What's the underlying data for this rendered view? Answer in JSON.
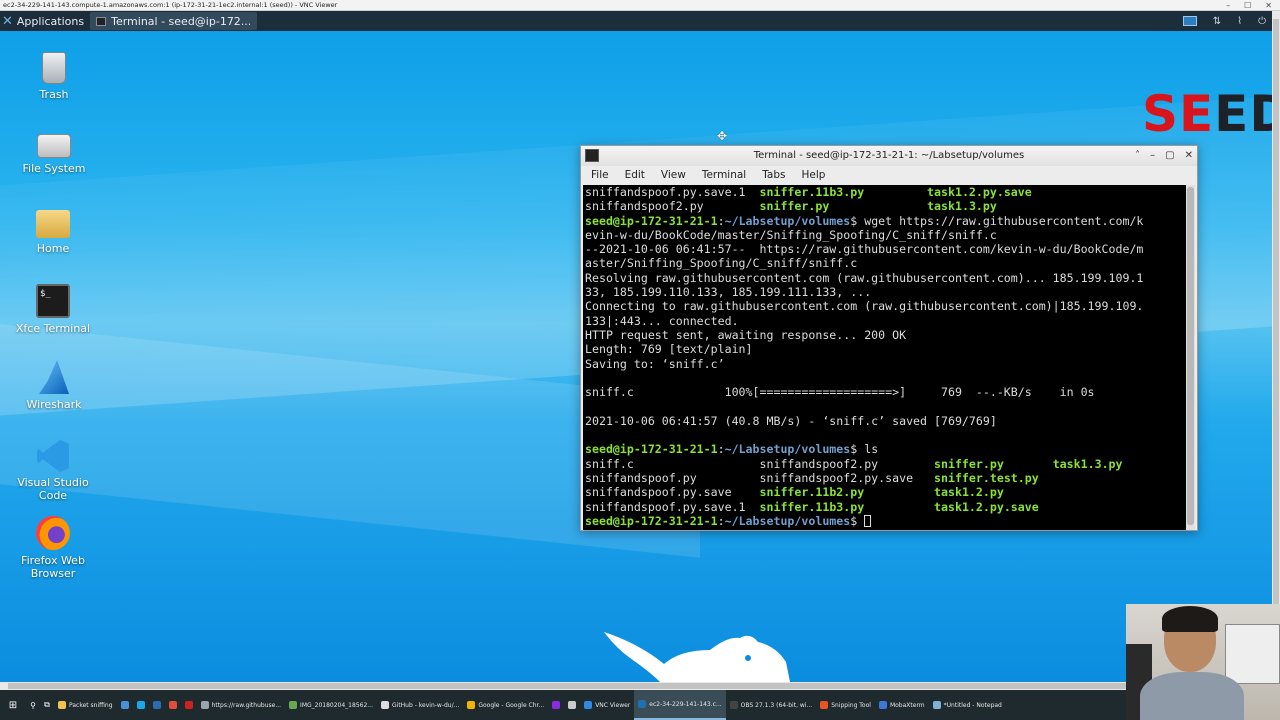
{
  "vnc": {
    "title": "ec2-34-229-141-143.compute-1.amazonaws.com:1 (ip-172-31-21-1ec2.internal:1 (seed)) - VNC Viewer",
    "minimize": "–",
    "maximize": "☐",
    "close": "✕"
  },
  "xfce_panel": {
    "applications_label": "Applications",
    "task_label": "Terminal - seed@ip-172...",
    "tray_symbols": [
      "⇅",
      "⌇",
      "⏻"
    ]
  },
  "desktop_icons": [
    {
      "label": "Trash",
      "icon": "trash-icon"
    },
    {
      "label": "File System",
      "icon": "drive-icon"
    },
    {
      "label": "Home",
      "icon": "folder-icon"
    },
    {
      "label": "Xfce Terminal",
      "icon": "terminal-icon"
    },
    {
      "label": "Wireshark",
      "icon": "wireshark-icon"
    },
    {
      "label": "Visual Studio Code",
      "icon": "vscode-icon"
    },
    {
      "label": "Firefox Web Browser",
      "icon": "firefox-icon"
    }
  ],
  "terminal_glyph": "$_",
  "seed_logo": {
    "letters": [
      "S",
      "E",
      "E",
      "D"
    ],
    "colors": [
      "#d9141b",
      "#d9141b",
      "#1d2128",
      "#1d2128"
    ]
  },
  "terminal": {
    "title": "Terminal - seed@ip-172-31-21-1: ~/Labsetup/volumes",
    "controls": [
      "˄",
      "–",
      "▢",
      "✕"
    ],
    "menu": [
      "File",
      "Edit",
      "View",
      "Terminal",
      "Tabs",
      "Help"
    ],
    "prompt_user": "seed@ip-172-31-21-1",
    "prompt_path": ":~/Labsetup/volumes",
    "prompt_end": "$",
    "lines": [
      [
        {
          "t": "sniffandspoof.py.save.1  ",
          "c": "w"
        },
        {
          "t": "sniffer.11b3.py",
          "c": "g"
        },
        {
          "t": "         ",
          "c": "w"
        },
        {
          "t": "task1.2.py.save",
          "c": "g"
        }
      ],
      [
        {
          "t": "sniffandspoof2.py        ",
          "c": "w"
        },
        {
          "t": "sniffer.py",
          "c": "g"
        },
        {
          "t": "              ",
          "c": "w"
        },
        {
          "t": "task1.3.py",
          "c": "g"
        }
      ],
      [
        {
          "t": "seed@ip-172-31-21-1",
          "c": "g"
        },
        {
          "t": ":",
          "c": "w"
        },
        {
          "t": "~/Labsetup/volumes",
          "c": "b"
        },
        {
          "t": "$ wget https://raw.githubusercontent.com/k",
          "c": "w"
        }
      ],
      [
        {
          "t": "evin-w-du/BookCode/master/Sniffing_Spoofing/C_sniff/sniff.c",
          "c": "w"
        }
      ],
      [
        {
          "t": "--2021-10-06 06:41:57--  https://raw.githubusercontent.com/kevin-w-du/BookCode/m",
          "c": "w"
        }
      ],
      [
        {
          "t": "aster/Sniffing_Spoofing/C_sniff/sniff.c",
          "c": "w"
        }
      ],
      [
        {
          "t": "Resolving raw.githubusercontent.com (raw.githubusercontent.com)... 185.199.109.1",
          "c": "w"
        }
      ],
      [
        {
          "t": "33, 185.199.110.133, 185.199.111.133, ...",
          "c": "w"
        }
      ],
      [
        {
          "t": "Connecting to raw.githubusercontent.com (raw.githubusercontent.com)|185.199.109.",
          "c": "w"
        }
      ],
      [
        {
          "t": "133|:443... connected.",
          "c": "w"
        }
      ],
      [
        {
          "t": "HTTP request sent, awaiting response... 200 OK",
          "c": "w"
        }
      ],
      [
        {
          "t": "Length: 769 [text/plain]",
          "c": "w"
        }
      ],
      [
        {
          "t": "Saving to: ‘sniff.c’",
          "c": "w"
        }
      ],
      [
        {
          "t": "",
          "c": "w"
        }
      ],
      [
        {
          "t": "sniff.c             100%[===================>]     769  --.-KB/s    in 0s",
          "c": "w"
        }
      ],
      [
        {
          "t": "",
          "c": "w"
        }
      ],
      [
        {
          "t": "2021-10-06 06:41:57 (40.8 MB/s) - ‘sniff.c’ saved [769/769]",
          "c": "w"
        }
      ],
      [
        {
          "t": "",
          "c": "w"
        }
      ],
      [
        {
          "t": "seed@ip-172-31-21-1",
          "c": "g"
        },
        {
          "t": ":",
          "c": "w"
        },
        {
          "t": "~/Labsetup/volumes",
          "c": "b"
        },
        {
          "t": "$ ls",
          "c": "w"
        }
      ],
      [
        {
          "t": "sniff.c                  sniffandspoof2.py        ",
          "c": "w"
        },
        {
          "t": "sniffer.py",
          "c": "g"
        },
        {
          "t": "       ",
          "c": "w"
        },
        {
          "t": "task1.3.py",
          "c": "g"
        }
      ],
      [
        {
          "t": "sniffandspoof.py         sniffandspoof2.py.save   ",
          "c": "w"
        },
        {
          "t": "sniffer.test.py",
          "c": "g"
        }
      ],
      [
        {
          "t": "sniffandspoof.py.save    ",
          "c": "w"
        },
        {
          "t": "sniffer.11b2.py",
          "c": "g"
        },
        {
          "t": "          ",
          "c": "w"
        },
        {
          "t": "task1.2.py",
          "c": "g"
        }
      ],
      [
        {
          "t": "sniffandspoof.py.save.1  ",
          "c": "w"
        },
        {
          "t": "sniffer.11b3.py",
          "c": "g"
        },
        {
          "t": "          ",
          "c": "w"
        },
        {
          "t": "task1.2.py.save",
          "c": "g"
        }
      ],
      [
        {
          "t": "seed@ip-172-31-21-1",
          "c": "g"
        },
        {
          "t": ":",
          "c": "w"
        },
        {
          "t": "~/Labsetup/volumes",
          "c": "b"
        },
        {
          "t": "$ ",
          "c": "w"
        },
        {
          "t": "",
          "c": "cursor"
        }
      ]
    ]
  },
  "win_taskbar": {
    "start_icon": "⊞",
    "sys_icons": [
      "⚲",
      "⧉"
    ],
    "items": [
      {
        "label": "Packet sniffing",
        "color": "#f2c14e"
      },
      {
        "label": "",
        "color": "#4a90d9"
      },
      {
        "label": "",
        "color": "#1aa7ec"
      },
      {
        "label": "",
        "color": "#2b6cb0"
      },
      {
        "label": "",
        "color": "#e04e39"
      },
      {
        "label": "",
        "color": "#cc2222"
      },
      {
        "label": "https://raw.githubuse...",
        "color": "#9aa4ab"
      },
      {
        "label": "IMG_20180204_18562...",
        "color": "#6aa84f"
      },
      {
        "label": "GitHub - kevin-w-du/...",
        "color": "#dddddd"
      },
      {
        "label": "Google - Google Chr...",
        "color": "#f4b400"
      },
      {
        "label": "",
        "color": "#8a2be2"
      },
      {
        "label": "",
        "color": "#cccccc"
      },
      {
        "label": "VNC Viewer",
        "color": "#2d8ae0"
      },
      {
        "label": "ec2-34-229-141-143.c...",
        "color": "#1f6fb2",
        "active": true
      },
      {
        "label": "OBS 27.1.3 (64-bit, wi...",
        "color": "#444444"
      },
      {
        "label": "Snipping Tool",
        "color": "#e95420"
      },
      {
        "label": "MobaXterm",
        "color": "#3c78d8"
      },
      {
        "label": "*Untitled - Notepad",
        "color": "#7fb3d5"
      }
    ]
  }
}
